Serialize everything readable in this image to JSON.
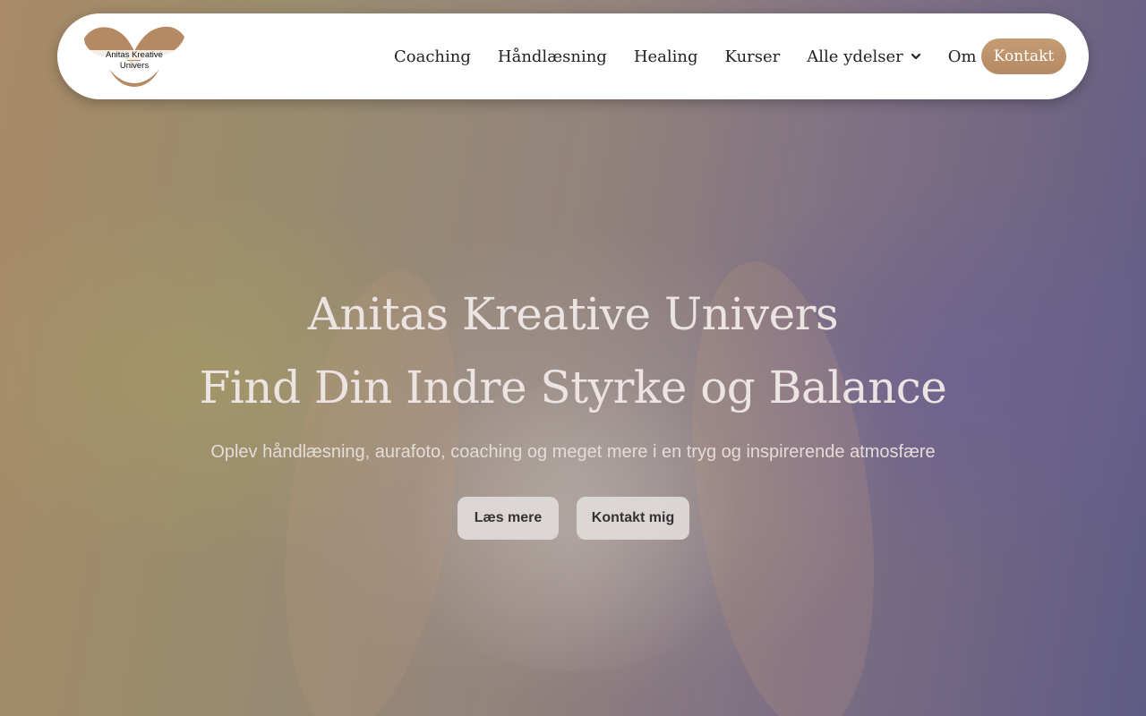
{
  "logo": {
    "name_line1": "Anitas Kreative",
    "name_line2": "Univers",
    "color": "#b58a62"
  },
  "nav": {
    "items": [
      {
        "label": "Coaching"
      },
      {
        "label": "Håndlæsning"
      },
      {
        "label": "Healing"
      },
      {
        "label": "Kurser"
      },
      {
        "label": "Alle ydelser",
        "icon": "chevron-down-icon"
      },
      {
        "label": "Om mig"
      }
    ],
    "contact_label": "Kontakt",
    "contact_color": "#c09870"
  },
  "hero": {
    "title_line1": "Anitas Kreative Univers",
    "title_line2": "Find Din Indre Styrke og Balance",
    "subtitle": "Oplev håndlæsning, aurafoto, coaching og meget mere i en tryg og inspirerende atmosfære",
    "primary_button": "Læs mere",
    "secondary_button": "Kontakt mig"
  }
}
